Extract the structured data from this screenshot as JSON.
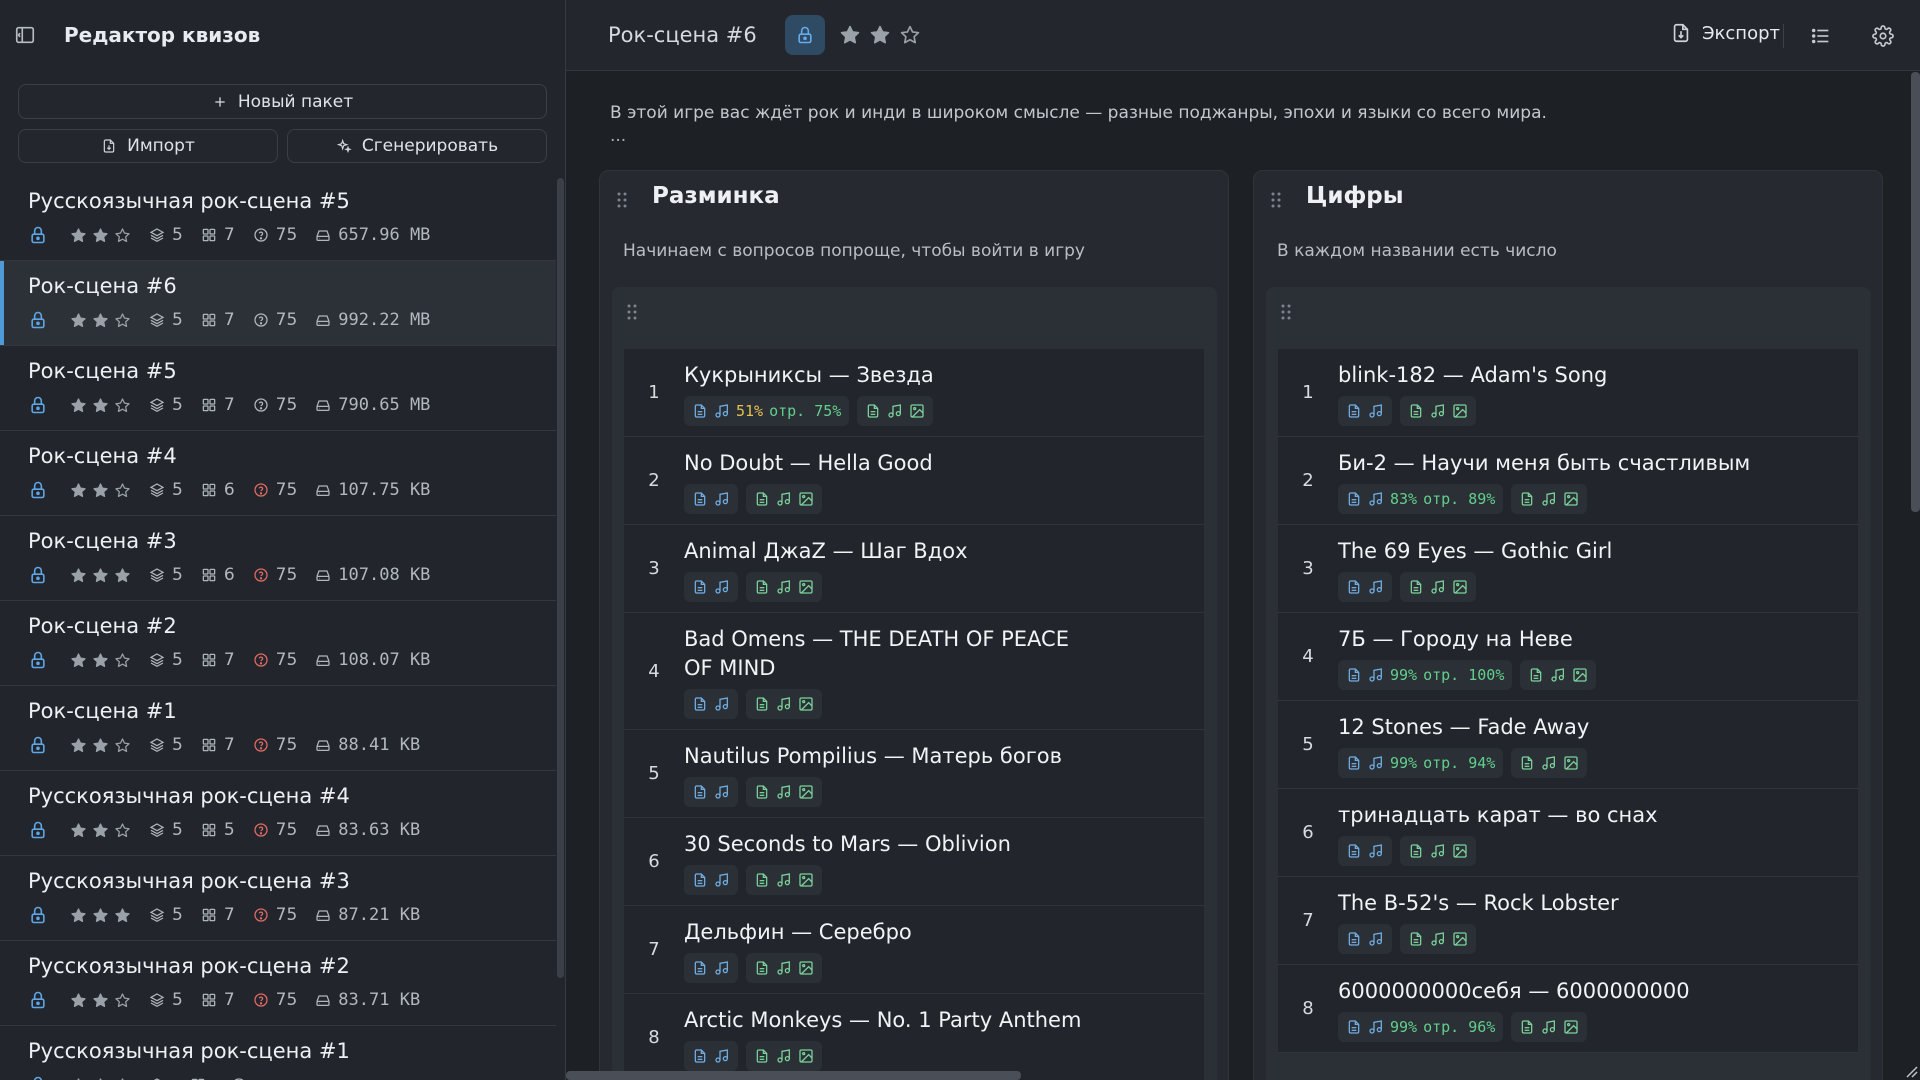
{
  "sidebar": {
    "title": "Редактор квизов",
    "new_pack": "Новый пакет",
    "import": "Импорт",
    "generate": "Сгенерировать",
    "packs": [
      {
        "name": "Русскоязычная рок-сцена #5",
        "stars": 2,
        "rounds": "5",
        "themes": "7",
        "questions": "75",
        "q_warn": false,
        "size": "657.96 MB"
      },
      {
        "name": "Рок-сцена #6",
        "stars": 2,
        "rounds": "5",
        "themes": "7",
        "questions": "75",
        "q_warn": false,
        "size": "992.22 MB",
        "active": true
      },
      {
        "name": "Рок-сцена #5",
        "stars": 2,
        "rounds": "5",
        "themes": "7",
        "questions": "75",
        "q_warn": false,
        "size": "790.65 MB"
      },
      {
        "name": "Рок-сцена #4",
        "stars": 2,
        "rounds": "5",
        "themes": "6",
        "questions": "75",
        "q_warn": true,
        "size": "107.75 KB"
      },
      {
        "name": "Рок-сцена #3",
        "stars": 3,
        "rounds": "5",
        "themes": "6",
        "questions": "75",
        "q_warn": true,
        "size": "107.08 KB"
      },
      {
        "name": "Рок-сцена #2",
        "stars": 2,
        "rounds": "5",
        "themes": "7",
        "questions": "75",
        "q_warn": true,
        "size": "108.07 KB"
      },
      {
        "name": "Рок-сцена #1",
        "stars": 2,
        "rounds": "5",
        "themes": "7",
        "questions": "75",
        "q_warn": true,
        "size": "88.41 KB"
      },
      {
        "name": "Русскоязычная рок-сцена #4",
        "stars": 2,
        "rounds": "5",
        "themes": "5",
        "questions": "75",
        "q_warn": true,
        "size": "83.63 KB"
      },
      {
        "name": "Русскоязычная рок-сцена #3",
        "stars": 3,
        "rounds": "5",
        "themes": "7",
        "questions": "75",
        "q_warn": true,
        "size": "87.21 KB"
      },
      {
        "name": "Русскоязычная рок-сцена #2",
        "stars": 2,
        "rounds": "5",
        "themes": "7",
        "questions": "75",
        "q_warn": true,
        "size": "83.71 KB"
      },
      {
        "name": "Русскоязычная рок-сцена #1",
        "stars": 2,
        "rounds": "",
        "themes": "",
        "questions": "",
        "q_warn": false,
        "size": ""
      }
    ]
  },
  "main": {
    "title": "Рок-сцена #6",
    "stars": 2,
    "export": "Экспорт",
    "description": "В этой игре вас ждёт рок и инди в широком смысле — разные поджанры, эпохи и языки со всего мира.",
    "more": "...",
    "rounds": [
      {
        "title": "Разминка",
        "subtitle": "Начинаем с вопросов попроще, чтобы войти в игру",
        "questions": [
          {
            "n": "1",
            "title": "Кукрыниксы — Звезда",
            "pct": "51%",
            "otr": "отр. 75%",
            "pct_warn": true
          },
          {
            "n": "2",
            "title": "No Doubt — Hella Good"
          },
          {
            "n": "3",
            "title": "Animal ДжаZ — Шаг Вдох"
          },
          {
            "n": "4",
            "title": "Bad Omens — THE DEATH OF PEACE OF MIND"
          },
          {
            "n": "5",
            "title": "Nautilus Pompilius — Матерь богов"
          },
          {
            "n": "6",
            "title": "30 Seconds to Mars — Oblivion"
          },
          {
            "n": "7",
            "title": "Дельфин — Серебро"
          },
          {
            "n": "8",
            "title": "Arctic Monkeys — No. 1 Party Anthem"
          }
        ]
      },
      {
        "title": "Цифры",
        "subtitle": "В каждом названии есть число",
        "questions": [
          {
            "n": "1",
            "title": "blink-182 — Adam's Song"
          },
          {
            "n": "2",
            "title": "Би-2 — Научи меня быть счастливым",
            "pct": "83%",
            "otr": "отр. 89%"
          },
          {
            "n": "3",
            "title": "The 69 Eyes — Gothic Girl"
          },
          {
            "n": "4",
            "title": "7Б — Городу на Неве",
            "pct": "99%",
            "otr": "отр. 100%"
          },
          {
            "n": "5",
            "title": "12 Stones — Fade Away",
            "pct": "99%",
            "otr": "отр. 94%"
          },
          {
            "n": "6",
            "title": "тринадцать карат — во снах"
          },
          {
            "n": "7",
            "title": "The B-52's — Rock Lobster"
          },
          {
            "n": "8",
            "title": "6000000000себя — 6000000000",
            "pct": "99%",
            "otr": "отр. 96%"
          }
        ]
      }
    ]
  },
  "icons": {
    "sidebar_toggle": "sidebar-toggle-icon",
    "lock": "lock-icon",
    "star": "star-icon",
    "rounds": "layers-icon",
    "themes": "grid-icon",
    "questions": "help-circle-icon",
    "size": "drive-icon",
    "doc": "file-text-icon",
    "music": "music-icon",
    "image": "image-icon",
    "export": "export-icon",
    "list": "list-icon",
    "settings": "gear-icon",
    "drag": "drag-handle-icon"
  },
  "colors": {
    "accent": "#5ea6e6",
    "warn": "#e06a64",
    "success": "#62cf8b",
    "warn_yellow": "#e5c04f"
  }
}
